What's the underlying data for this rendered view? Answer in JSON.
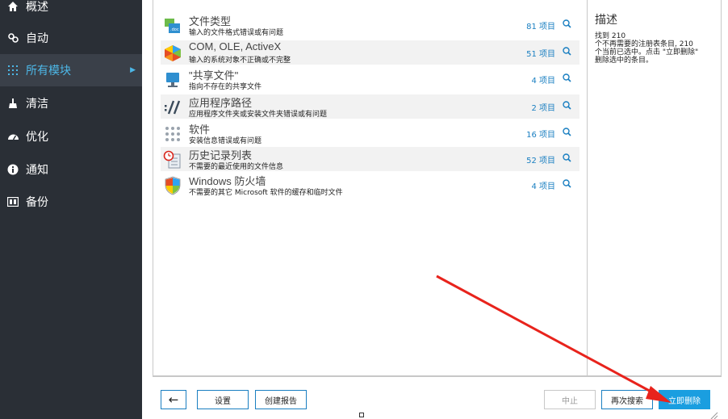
{
  "sidebar": {
    "items": [
      {
        "label": "概述",
        "icon": "home-icon"
      },
      {
        "label": "自动",
        "icon": "auto-icon"
      },
      {
        "label": "所有模块",
        "icon": "grid-icon",
        "active": true
      },
      {
        "label": "清洁",
        "icon": "broom-icon"
      },
      {
        "label": "优化",
        "icon": "speedometer-icon"
      },
      {
        "label": "通知",
        "icon": "info-icon"
      },
      {
        "label": "备份",
        "icon": "backup-icon"
      }
    ]
  },
  "categories": [
    {
      "title": "文件类型",
      "desc": "输入的文件格式错误或有问题",
      "count": "81 项目",
      "icon": "file-type-icon"
    },
    {
      "title": "COM, OLE, ActiveX",
      "desc": "输入的系统对象不正确或不完整",
      "count": "51 项目",
      "icon": "com-ole-icon"
    },
    {
      "title": "\"共享文件\"",
      "desc": "指向不存在的共享文件",
      "count": "4 项目",
      "icon": "shared-file-icon"
    },
    {
      "title": "应用程序路径",
      "desc": "应用程序文件夹或安装文件夹错误或有问题",
      "count": "2 项目",
      "icon": "app-path-icon"
    },
    {
      "title": "软件",
      "desc": "安装信息错误或有问题",
      "count": "16 项目",
      "icon": "software-icon"
    },
    {
      "title": "历史记录列表",
      "desc": "不需要的最近使用的文件信息",
      "count": "52 项目",
      "icon": "history-icon"
    },
    {
      "title": "Windows 防火墙",
      "desc": "不需要的其它 Microsoft 软件的缓存和临时文件",
      "count": "4 项目",
      "icon": "firewall-icon"
    }
  ],
  "description": {
    "title": "描述",
    "lines": [
      "找到 210",
      "个不再需要的注册表条目, 210",
      "个当前已选中。点击 \"立即删除\"",
      "删除选中的条目。"
    ]
  },
  "toolbar": {
    "back_label": "←",
    "settings_label": "设置",
    "report_label": "创建报告",
    "stop_label": "中止",
    "rescan_label": "再次搜索",
    "delete_label": "立即删除"
  },
  "colors": {
    "sidebar_bg": "#2a2f36",
    "accent": "#1a9ee0",
    "count_blue": "#1a7fc1",
    "arrow_red": "#e8231c"
  }
}
